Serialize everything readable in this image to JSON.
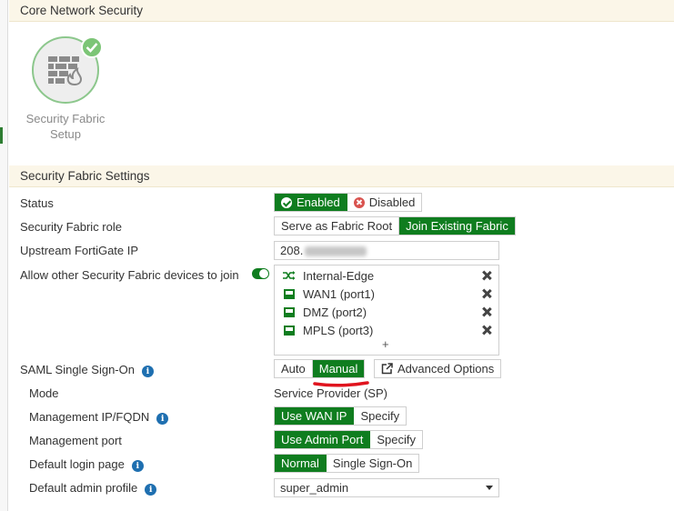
{
  "header": {
    "title": "Core Network Security"
  },
  "fabric_tile": {
    "label_line1": "Security Fabric",
    "label_line2": "Setup",
    "status_color": "#7cc576"
  },
  "settings": {
    "section_title": "Security Fabric Settings",
    "status": {
      "label": "Status",
      "options": [
        "Enabled",
        "Disabled"
      ],
      "selected": "Enabled"
    },
    "role": {
      "label": "Security Fabric role",
      "options": [
        "Serve as Fabric Root",
        "Join Existing Fabric"
      ],
      "selected": "Join Existing Fabric"
    },
    "upstream_ip": {
      "label": "Upstream FortiGate IP",
      "value": "208."
    },
    "allow_join": {
      "label": "Allow other Security Fabric devices to join",
      "enabled": true,
      "items": [
        {
          "label": "Internal-Edge",
          "icon": "shuffle-icon"
        },
        {
          "label": "WAN1 (port1)",
          "icon": "port-icon"
        },
        {
          "label": "DMZ (port2)",
          "icon": "port-icon"
        },
        {
          "label": "MPLS (port3)",
          "icon": "port-icon"
        }
      ],
      "add_symbol": "+"
    },
    "saml": {
      "label": "SAML Single Sign-On",
      "options": [
        "Auto",
        "Manual"
      ],
      "selected": "Manual",
      "advanced_label": "Advanced Options"
    },
    "mode": {
      "label": "Mode",
      "value": "Service Provider (SP)"
    },
    "mgmt_ip": {
      "label": "Management IP/FQDN",
      "options": [
        "Use WAN IP",
        "Specify"
      ],
      "selected": "Use WAN IP"
    },
    "mgmt_port": {
      "label": "Management port",
      "options": [
        "Use Admin Port",
        "Specify"
      ],
      "selected": "Use Admin Port"
    },
    "login_page": {
      "label": "Default login page",
      "options": [
        "Normal",
        "Single Sign-On"
      ],
      "selected": "Normal"
    },
    "admin_profile": {
      "label": "Default admin profile",
      "value": "super_admin"
    }
  },
  "colors": {
    "accent_green": "#0f7d1f",
    "disabled_red": "#d9534f",
    "info_blue": "#1e6fb0",
    "annotation_red": "#e0141e"
  }
}
